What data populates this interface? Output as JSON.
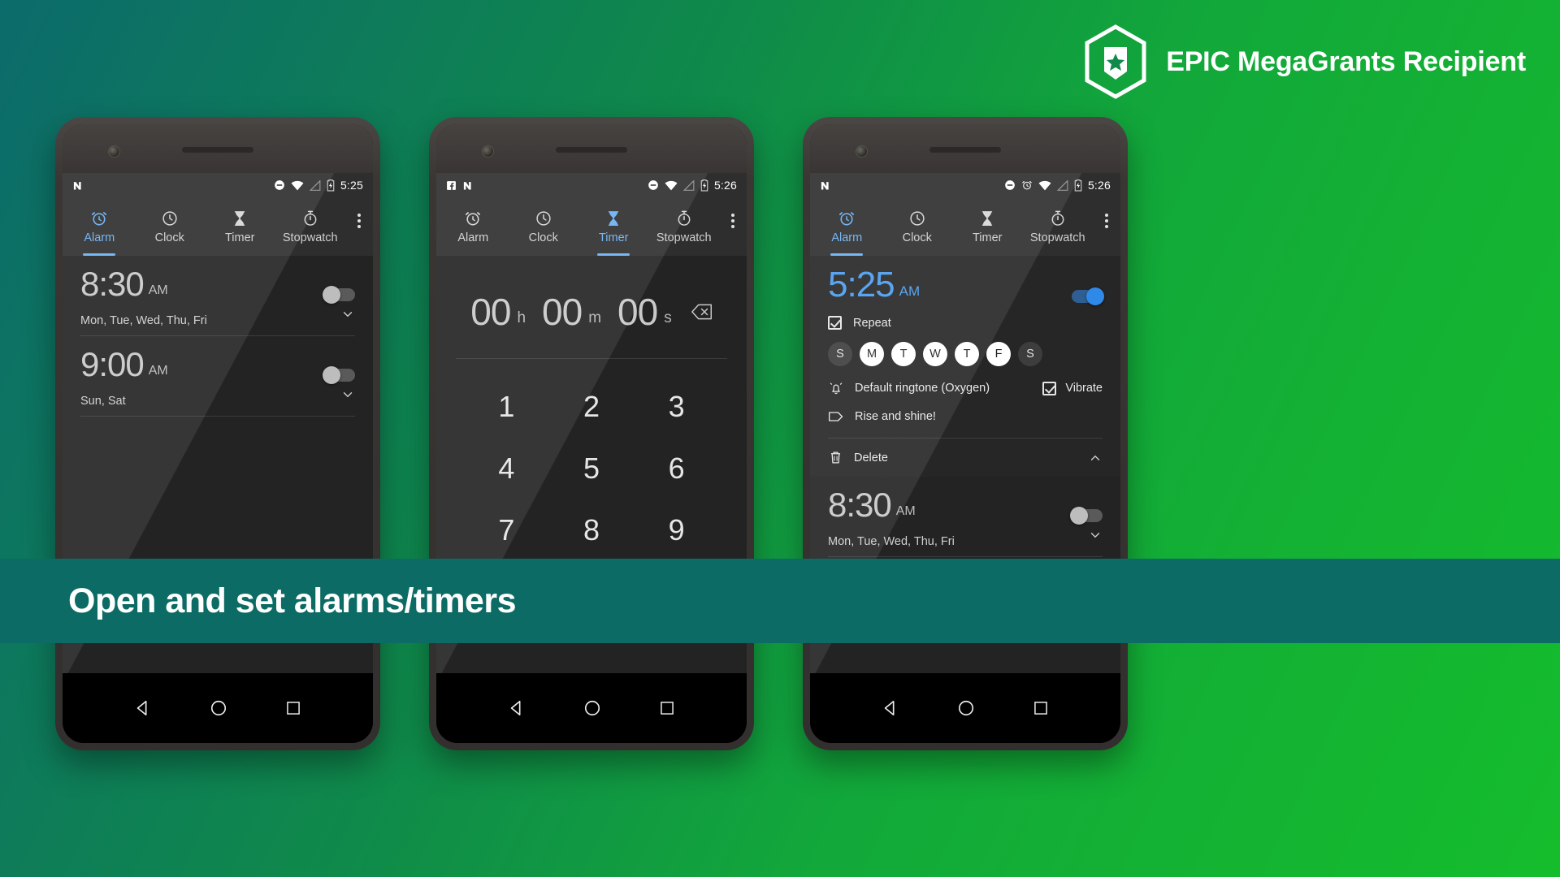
{
  "badge": {
    "text": "EPIC MegaGrants Recipient",
    "icon": "epic-megagrants-hex-shield-star-icon",
    "color": "#ffffff"
  },
  "caption": {
    "text": "Open and set alarms/timers",
    "background": "#0c6b64"
  },
  "theme": {
    "accent": "#4a9df0",
    "tab_active": "#6ab0f3",
    "screen_bg": "#232323",
    "statusbar_bg": "#2e2e2e",
    "gradient_from": "#0c6b6b",
    "gradient_to": "#15bd2c"
  },
  "tabs": [
    {
      "label": "Alarm",
      "icon": "alarm-clock-icon"
    },
    {
      "label": "Clock",
      "icon": "clock-icon"
    },
    {
      "label": "Timer",
      "icon": "hourglass-icon"
    },
    {
      "label": "Stopwatch",
      "icon": "stopwatch-icon"
    }
  ],
  "navbar": {
    "back": "back-triangle-icon",
    "home": "home-circle-icon",
    "recents": "recents-square-icon"
  },
  "phones": [
    {
      "id": "phone-alarm-list",
      "statusbar": {
        "time": "5:25",
        "icons": [
          "android-n-icon",
          "dnd-icon",
          "wifi-icon",
          "signal-off-icon",
          "battery-charging-icon"
        ]
      },
      "active_tab": "Alarm",
      "alarms": [
        {
          "time": "8:30",
          "ampm": "AM",
          "days": "Mon, Tue, Wed, Thu, Fri",
          "enabled": false
        },
        {
          "time": "9:00",
          "ampm": "AM",
          "days": "Sun, Sat",
          "enabled": false
        }
      ]
    },
    {
      "id": "phone-timer",
      "statusbar": {
        "time": "5:26",
        "icons": [
          "facebook-icon",
          "android-n-icon",
          "dnd-icon",
          "wifi-icon",
          "signal-off-icon",
          "battery-charging-icon"
        ]
      },
      "active_tab": "Timer",
      "timer": {
        "hours": "00",
        "hours_unit": "h",
        "minutes": "00",
        "minutes_unit": "m",
        "seconds": "00",
        "seconds_unit": "s",
        "backspace_icon": "backspace-icon",
        "keys": [
          "1",
          "2",
          "3",
          "4",
          "5",
          "6",
          "7",
          "8",
          "9"
        ]
      }
    },
    {
      "id": "phone-alarm-edit",
      "statusbar": {
        "time": "5:26",
        "icons": [
          "android-n-icon",
          "dnd-icon",
          "alarm-set-icon",
          "wifi-icon",
          "signal-off-icon",
          "battery-charging-icon"
        ]
      },
      "active_tab": "Alarm",
      "expanded_alarm": {
        "time": "5:25",
        "ampm": "AM",
        "enabled": true,
        "repeat_label": "Repeat",
        "repeat_checked": true,
        "days": [
          {
            "letter": "S",
            "on": false
          },
          {
            "letter": "M",
            "on": true
          },
          {
            "letter": "T",
            "on": true
          },
          {
            "letter": "W",
            "on": true
          },
          {
            "letter": "T",
            "on": true
          },
          {
            "letter": "F",
            "on": true
          },
          {
            "letter": "S",
            "on": false
          }
        ],
        "ringtone_label": "Default ringtone (Oxygen)",
        "ringtone_icon": "bell-ringing-icon",
        "vibrate_label": "Vibrate",
        "vibrate_checked": true,
        "tag_label": "Rise and shine!",
        "tag_icon": "label-tag-icon",
        "delete_label": "Delete",
        "delete_icon": "trash-icon",
        "collapse_icon": "chevron-up-icon"
      },
      "alarms": [
        {
          "time": "8:30",
          "ampm": "AM",
          "days": "Mon, Tue, Wed, Thu, Fri",
          "enabled": false
        }
      ]
    }
  ]
}
